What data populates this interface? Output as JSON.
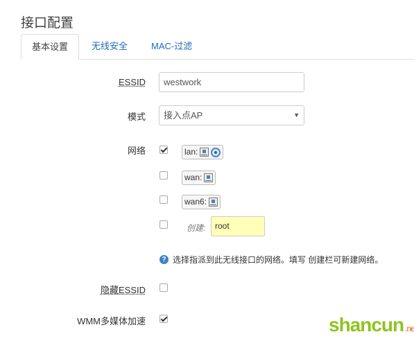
{
  "section_title": "接口配置",
  "tabs": [
    {
      "label": "基本设置",
      "active": true
    },
    {
      "label": "无线安全",
      "active": false
    },
    {
      "label": "MAC-过滤",
      "active": false
    }
  ],
  "essid": {
    "label": "ESSID",
    "value": "westwork"
  },
  "mode": {
    "label": "模式",
    "value": "接入点AP"
  },
  "network": {
    "label": "网络",
    "options": [
      {
        "name": "lan:",
        "checked": true
      },
      {
        "name": "wan:",
        "checked": false
      },
      {
        "name": "wan6:",
        "checked": false
      }
    ],
    "create_label": "创建:",
    "create_value": "root",
    "help_text": "选择指派到此无线接口的网络。填写 创建栏可新建网络。"
  },
  "hide_essid": {
    "label": "隐藏ESSID",
    "checked": false
  },
  "wmm": {
    "label": "WMM多媒体加速",
    "checked": true
  },
  "watermark": {
    "text": "shancun",
    "suffix": ".net"
  }
}
